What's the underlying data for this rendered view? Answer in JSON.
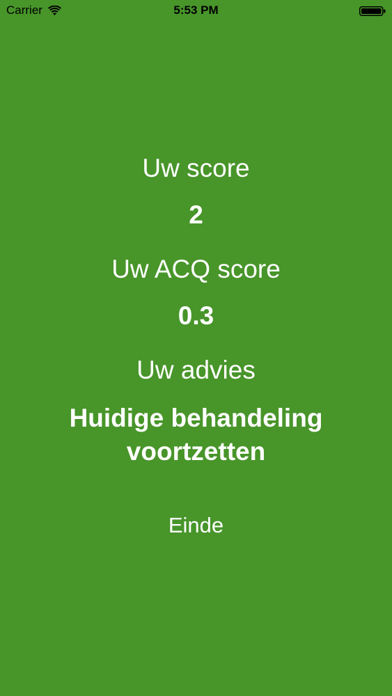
{
  "status_bar": {
    "carrier": "Carrier",
    "time": "5:53 PM",
    "wifi_icon": "wifi-icon",
    "battery_icon": "battery-icon"
  },
  "result": {
    "score_label": "Uw score",
    "score_value": "2",
    "acq_label": "Uw ACQ score",
    "acq_value": "0.3",
    "advice_label": "Uw advies",
    "advice_value": "Huidige behandeling voortzetten"
  },
  "actions": {
    "end_label": "Einde"
  },
  "colors": {
    "background": "#48952a",
    "text": "#ffffff"
  }
}
